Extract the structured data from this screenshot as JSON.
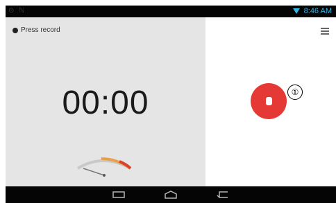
{
  "status": {
    "time": "8:46 AM",
    "left_icons": "⊙ ℕ"
  },
  "recorder": {
    "status_text": "Press record",
    "timer": "00:00",
    "callout": "①"
  },
  "colors": {
    "record": "#e53935",
    "accent": "#33b5e5"
  }
}
